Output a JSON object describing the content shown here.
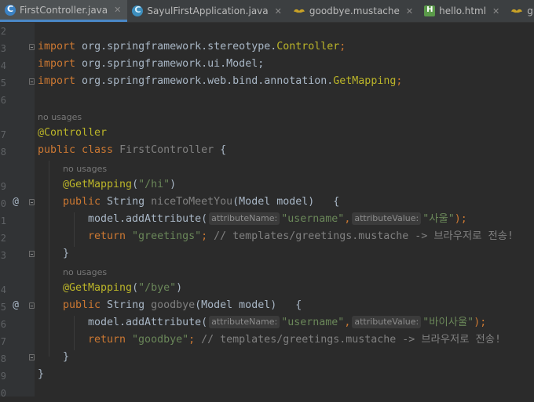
{
  "tabs": [
    {
      "label": "FirstController.java",
      "icon": "java-class-icon",
      "active": true
    },
    {
      "label": "SayulFirstApplication.java",
      "icon": "spring-boot-class-icon",
      "active": false
    },
    {
      "label": "goodbye.mustache",
      "icon": "mustache-icon",
      "active": false
    },
    {
      "label": "hello.html",
      "icon": "html-icon",
      "active": false
    },
    {
      "label": "greetings.must",
      "icon": "mustache-icon",
      "active": false
    }
  ],
  "close_glyph": "✕",
  "line_numbers": [
    "2",
    "3",
    "4",
    "5",
    "6",
    "7",
    "8",
    "9",
    "0",
    "1",
    "2",
    "3",
    "4",
    "5",
    "6",
    "7",
    "8",
    "9",
    "0",
    "1",
    "2"
  ],
  "hints": {
    "usage": "no usages",
    "param_name": "attributeName:",
    "param_value": "attributeValue:"
  },
  "code": {
    "import1_kw": "import",
    "import1_path": " org.springframework.stereotype.",
    "import1_cls": "Controller",
    "import1_end": ";",
    "import2_kw": "import",
    "import2_path": " org.springframework.ui.Model;",
    "import3_kw": "import",
    "import3_path": " org.springframework.web.bind.annotation.",
    "import3_cls": "GetMapping",
    "import3_end": ";",
    "ann_controller": "@Controller",
    "class_kw": "public class ",
    "class_name": "FirstController",
    " class_open": " {",
    "class_open": " {",
    "getmapping": "@GetMapping",
    "paren_open": "(",
    "paren_close": ")",
    "hi_path": "\"/hi\"",
    "bye_path": "\"/bye\"",
    "public_kw": "public ",
    "string_type": "String ",
    "m1_name": "niceToMeetYou",
    "m1_sig": "(Model model)   {",
    "m2_name": "goodbye",
    "m2_sig": "(Model model)   {",
    "add_attr": "model.addAttribute(",
    "username": "\"username\"",
    "comma": ",",
    "val1": "\"사울\"",
    "val2": "\"바이사울\"",
    "close_stmt": ");",
    "return_kw": "return ",
    "ret1": "\"greetings\"",
    "ret2": "\"goodbye\"",
    "semi": ";",
    "comment": " // templates/greetings.mustache -> 브라우저로 전송!",
    "brace_close": "}"
  },
  "gutter_marks": {
    "bean": "@"
  }
}
